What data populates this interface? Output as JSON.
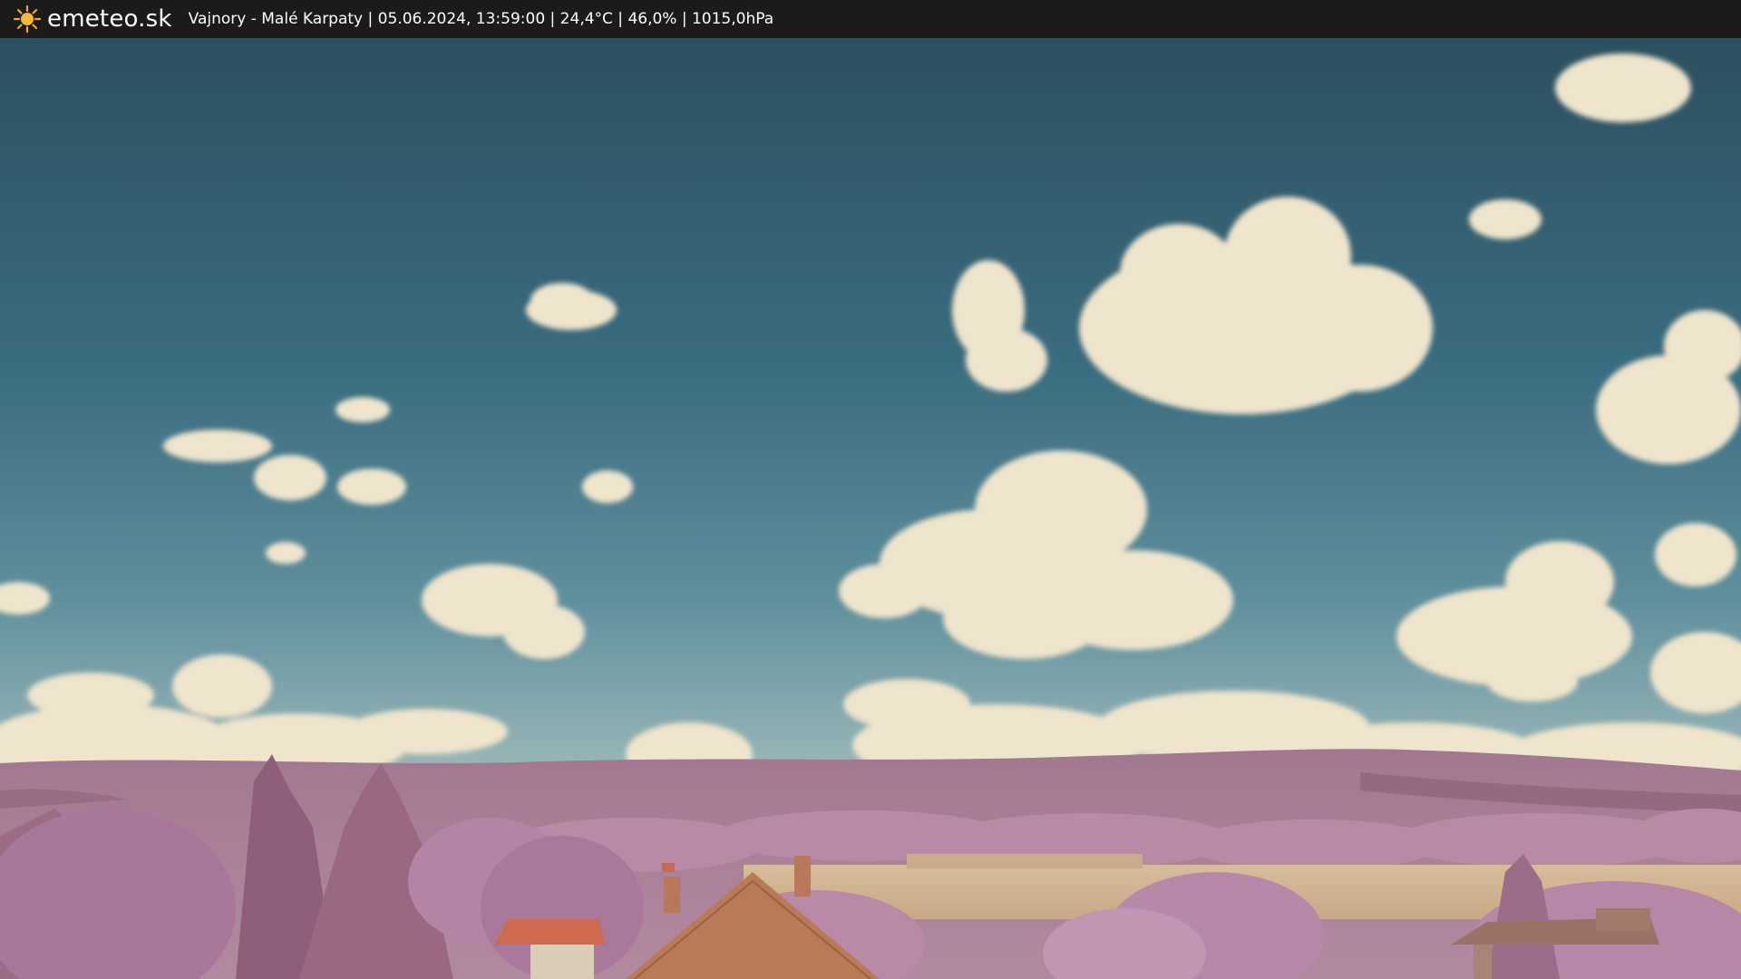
{
  "header": {
    "brand": "emeteo.sk",
    "caption": "Vajnory - Malé Karpaty | 05.06.2024, 13:59:00 | 24,4°C | 46,0% | 1015,0hPa",
    "logo_icon": "sun-icon",
    "logo_color": "#f5a623"
  },
  "scene": {
    "description_icon": "webcam-image",
    "colors": {
      "sky_top": "#2f5766",
      "sky_mid": "#3d7388",
      "sky_horizon": "#8fb0b6",
      "cloud": "#f0e6cf",
      "hills": "#a77b94",
      "trees": "#b98aa8",
      "trees_dark": "#8f5f7a",
      "field": "#d2b694",
      "roof": "#b97a58",
      "roof_red": "#d06a4e"
    }
  }
}
